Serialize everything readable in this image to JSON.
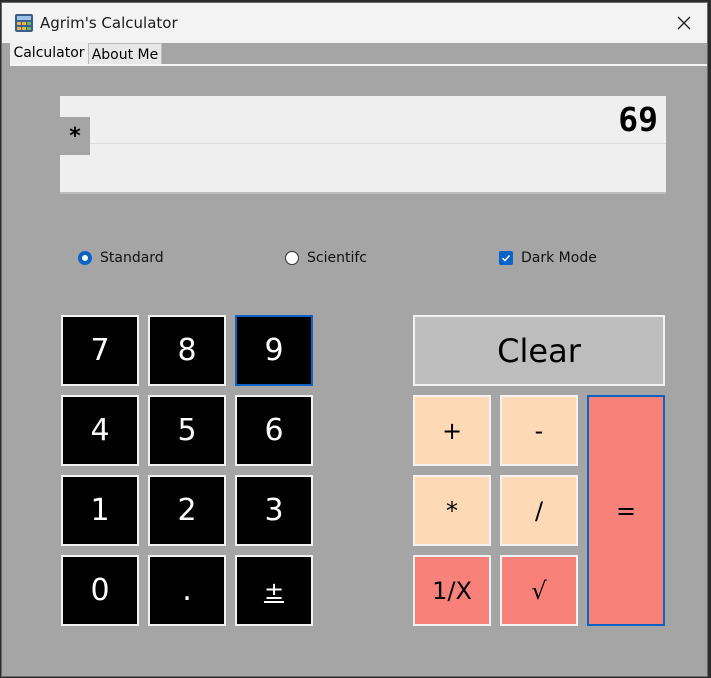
{
  "window": {
    "title": "Agrim's Calculator",
    "close_glyph": "✕"
  },
  "tabs": [
    {
      "label": "Calculator",
      "active": true
    },
    {
      "label": "About Me",
      "active": false
    }
  ],
  "display": {
    "value": "69",
    "operator": "*"
  },
  "options": {
    "standard": {
      "label": "Standard",
      "checked": true
    },
    "scientific": {
      "label": "Scientifc",
      "checked": false
    },
    "dark_mode": {
      "label": "Dark Mode",
      "checked": true
    }
  },
  "keypad": {
    "digits": [
      "7",
      "8",
      "9",
      "4",
      "5",
      "6",
      "1",
      "2",
      "3",
      "0",
      ".",
      "±"
    ]
  },
  "operators": {
    "clear": "Clear",
    "plus": "+",
    "minus": "-",
    "multiply": "*",
    "divide": "/",
    "reciprocal": "1/X",
    "sqrt": "√",
    "equals": "="
  },
  "colors": {
    "background": "#a5a5a5",
    "digit_key": "#000000",
    "operator_key": "#fdd9b6",
    "function_key": "#f8827a",
    "clear_key": "#bdbdbd",
    "accent": "#0b63c8"
  }
}
